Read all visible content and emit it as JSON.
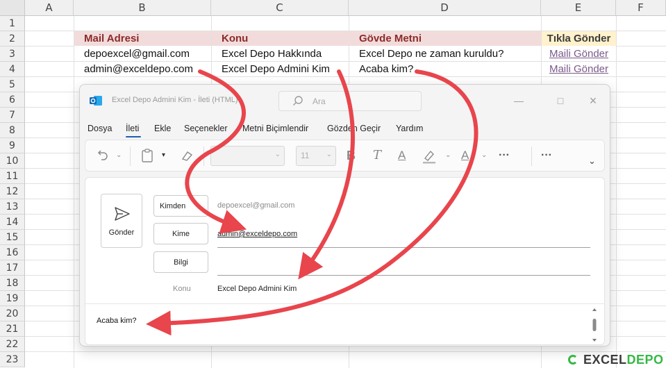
{
  "sheet": {
    "columns": [
      "A",
      "B",
      "C",
      "D",
      "E",
      "F"
    ],
    "rows": [
      "1",
      "2",
      "3",
      "4",
      "5",
      "6",
      "7",
      "8",
      "9",
      "10",
      "11",
      "12",
      "13",
      "14",
      "15",
      "16",
      "17",
      "18",
      "19",
      "20",
      "21",
      "22",
      "23"
    ],
    "table": {
      "headers": [
        "Mail Adresi",
        "Konu",
        "Gövde Metni",
        "Tıkla Gönder"
      ],
      "rows": [
        [
          "depoexcel@gmail.com",
          "Excel Depo Hakkında",
          "Excel Depo ne zaman kuruldu?",
          "Maili Gönder"
        ],
        [
          "admin@exceldepo.com",
          "Excel Depo Admini Kim",
          "Acaba kim?",
          "Maili Gönder"
        ]
      ]
    }
  },
  "outlook": {
    "title": "Excel Depo Admini Kim  -  İleti (HTML)",
    "search_placeholder": "Ara",
    "menu": [
      "Dosya",
      "İleti",
      "Ekle",
      "Seçenekler",
      "Metni Biçimlendir",
      "Gözden Geçir",
      "Yardım"
    ],
    "active_menu": "İleti",
    "ribbon": {
      "font_size": "11",
      "more": "···"
    },
    "compose": {
      "send_label": "Gönder",
      "from_label": "Kimden",
      "from_value": "depoexcel@gmail.com",
      "to_label": "Kime",
      "to_value": "admin@exceldepo.com",
      "cc_label": "Bilgi",
      "subject_label": "Konu",
      "subject_value": "Excel Depo Admini Kim",
      "body": "Acaba kim?"
    }
  },
  "watermark": {
    "part1": "EXCEL",
    "part2": "DEPO"
  },
  "colors": {
    "header_fill": "#f2dcdb",
    "header_text": "#8b2a2a",
    "send_header_fill": "#fff2cc",
    "link": "#7a5a8a",
    "arrow": "#e8454c",
    "outlook_blue": "#0f6cbd"
  },
  "icons": [
    "outlook-logo-icon",
    "search-icon",
    "minimize-icon",
    "maximize-icon",
    "close-icon",
    "undo-icon",
    "clipboard-icon",
    "format-painter-icon",
    "bold-icon",
    "italic-icon",
    "underline-icon",
    "highlighter-icon",
    "font-color-icon",
    "send-icon",
    "chevron-down-icon"
  ]
}
